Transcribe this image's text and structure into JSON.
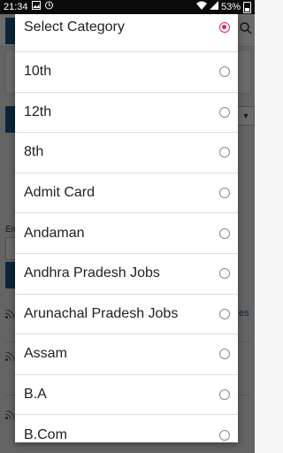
{
  "status_bar": {
    "time": "21:34",
    "battery": "53%",
    "icons": [
      "image-icon",
      "alarm-icon",
      "wifi-icon",
      "signal-icon",
      "battery-icon"
    ]
  },
  "background": {
    "label_em": "Em",
    "link_es": "es",
    "dropdown_arrow": "▼"
  },
  "dialog": {
    "accent_color": "#e0245e",
    "options": [
      {
        "label": "Select Category",
        "selected": true
      },
      {
        "label": "10th",
        "selected": false
      },
      {
        "label": "12th",
        "selected": false
      },
      {
        "label": "8th",
        "selected": false
      },
      {
        "label": "Admit Card",
        "selected": false
      },
      {
        "label": "Andaman",
        "selected": false
      },
      {
        "label": "Andhra Pradesh Jobs",
        "selected": false
      },
      {
        "label": "Arunachal Pradesh Jobs",
        "selected": false
      },
      {
        "label": "Assam",
        "selected": false
      },
      {
        "label": "B.A",
        "selected": false
      },
      {
        "label": "B.Com",
        "selected": false
      }
    ]
  }
}
